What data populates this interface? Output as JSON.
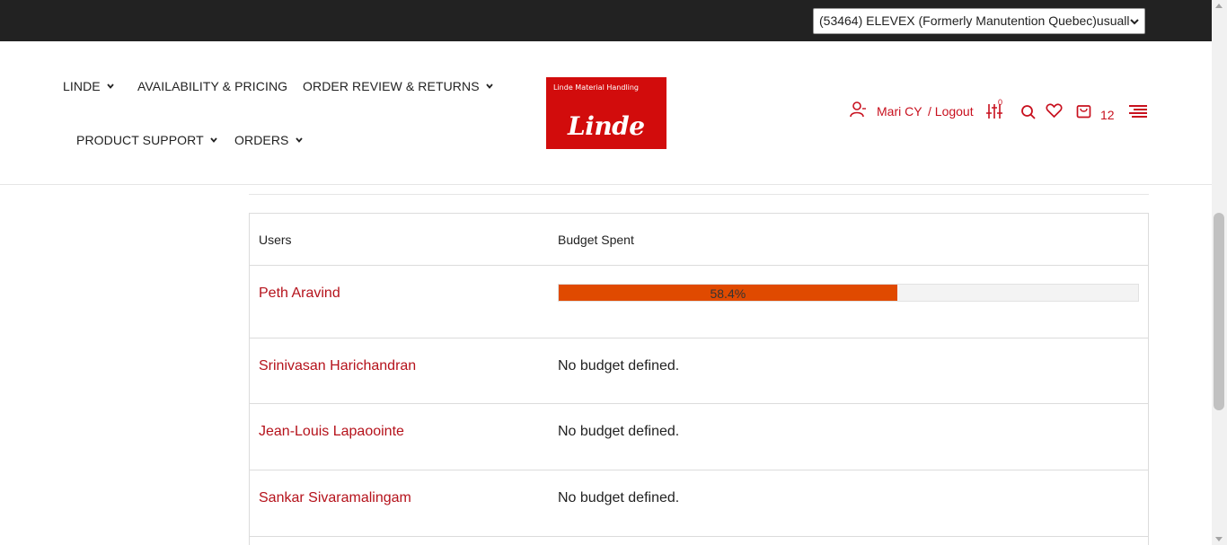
{
  "account_select": {
    "value": "(53464) ELEVEX (Formerly Manutention Quebec)usuall"
  },
  "nav": {
    "linde": "LINDE",
    "availability": "AVAILABILITY & PRICING",
    "order_review": "ORDER REVIEW & RETURNS",
    "product_support": "PRODUCT SUPPORT",
    "orders": "ORDERS"
  },
  "logo": {
    "tagline": "Linde Material Handling",
    "wordmark": "Linde"
  },
  "user": {
    "name": "Mari CY",
    "logout": "/ Logout",
    "compare_count": "0",
    "cart_count": "12"
  },
  "icons": [
    "user-icon",
    "compare-icon",
    "search-icon",
    "heart-icon",
    "cart-icon",
    "menu-icon",
    "chevron-down-icon"
  ],
  "colors": {
    "brand_red": "#d20c0c",
    "link_red": "#b5121b",
    "progress_fill": "#e04a00",
    "topbar": "#222222"
  },
  "table": {
    "headers": {
      "users": "Users",
      "budget": "Budget Spent"
    },
    "rows": [
      {
        "user": "Peth Aravind",
        "budget_percent": 58.4,
        "budget_label": "58.4%"
      },
      {
        "user": "Srinivasan Harichandran",
        "budget_text": "No budget defined."
      },
      {
        "user": "Jean-Louis Lapaoointe",
        "budget_text": "No budget defined."
      },
      {
        "user": "Sankar Sivaramalingam",
        "budget_text": "No budget defined."
      }
    ]
  }
}
